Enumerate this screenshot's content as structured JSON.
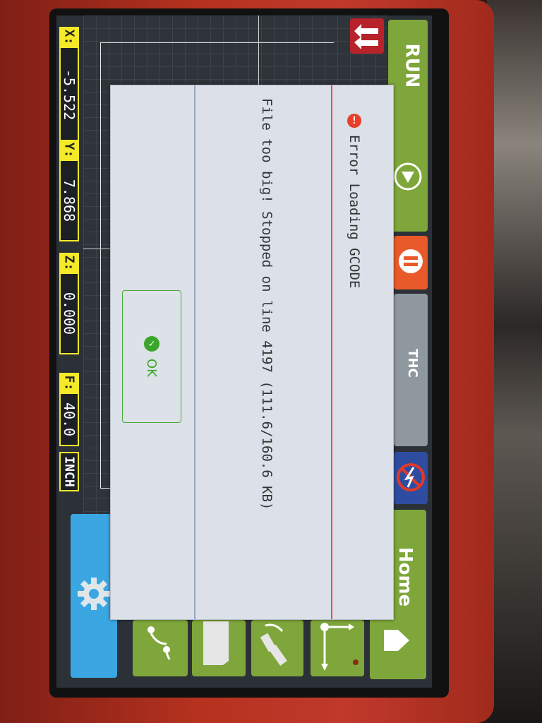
{
  "readouts": {
    "x": {
      "label": "X:",
      "value": "-5.522"
    },
    "y": {
      "label": "Y:",
      "value": "7.868"
    },
    "z": {
      "label": "Z:",
      "value": "0.000"
    },
    "f": {
      "label": "F:",
      "value": "40.0"
    },
    "unit": "INCH"
  },
  "right_panel": {
    "run_label": "RUN",
    "thc_label": "THC",
    "home_label": "Home"
  },
  "dialog": {
    "title": "Error Loading GCODE",
    "message": "File too big! Stopped on line 4197 (111.6/160.6 KB)",
    "ok_label": "OK",
    "error_icon": "!",
    "check_icon": "✓"
  },
  "colors": {
    "run_green": "#7ea63a",
    "pause_orange": "#e85a2a",
    "readout_yellow": "#f4ea28",
    "settings_blue": "#3aa6e2",
    "error_red": "#e8402a",
    "ok_green": "#3aa62a"
  },
  "icons": [
    "arrows-icon",
    "play-icon",
    "pause-icon",
    "no-laser-icon",
    "home-icon",
    "gear-icon",
    "probe-icon",
    "folder-icon",
    "robot-arm-icon",
    "axes-icon"
  ]
}
